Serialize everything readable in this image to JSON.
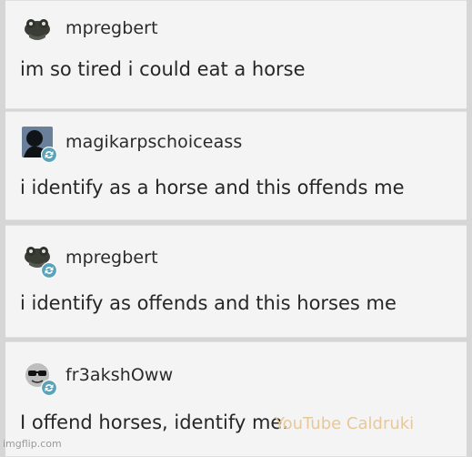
{
  "posts": [
    {
      "username": "mpregbert",
      "message": "im so tired i could eat a horse",
      "avatar_icon": "frog-avatar-icon"
    },
    {
      "username": "magikarpschoiceass",
      "message": "i identify as a horse and this offends me",
      "avatar_icon": "person-avatar-icon",
      "reblog": true
    },
    {
      "username": "mpregbert",
      "message": "i identify as offends and this horses me",
      "avatar_icon": "frog-avatar-icon",
      "reblog": true
    },
    {
      "username": "fr3akshOww",
      "message": "I offend horses, identify me.",
      "avatar_icon": "sunglasses-avatar-icon",
      "reblog": true
    }
  ],
  "watermark": "YouTube Caldruki",
  "footer": "imgflip.com",
  "colors": {
    "background": "#d6d6d6",
    "card": "#f4f4f4",
    "text": "#262626",
    "reblog": "#5ba3b8",
    "watermark": "#e8c89a"
  }
}
